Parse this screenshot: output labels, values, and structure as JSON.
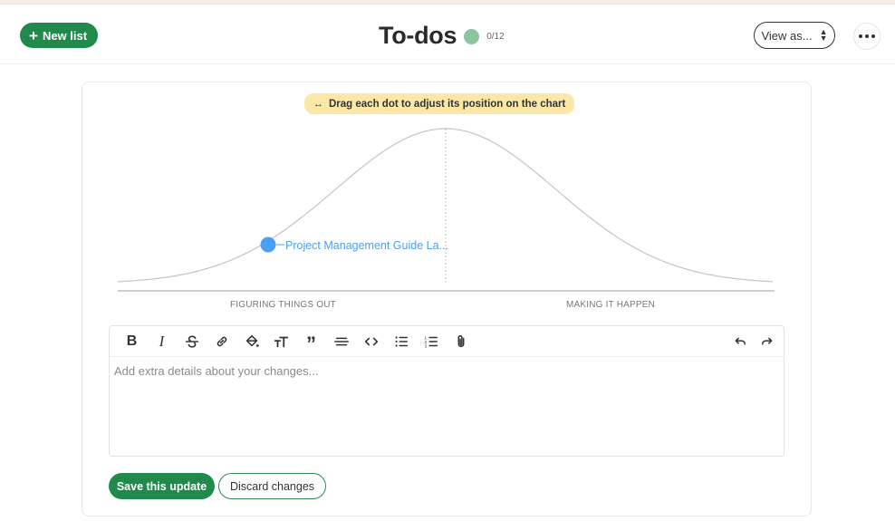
{
  "header": {
    "new_list_label": "New list",
    "title": "To-dos",
    "progress_count": "0/12",
    "view_as_label": "View as..."
  },
  "hillchart": {
    "hint": "Drag each dot to adjust its position on the chart",
    "left_label": "FIGURING THINGS OUT",
    "right_label": "MAKING IT HAPPEN",
    "item_label": "Project Management Guide La...",
    "item_color": "#4a9ff5"
  },
  "editor": {
    "placeholder": "Add extra details about your changes..."
  },
  "actions": {
    "save_label": "Save this update",
    "discard_label": "Discard changes"
  },
  "colors": {
    "brand_green": "#1f8a4c",
    "progress_dot": "#8ec3a0",
    "hint_bg": "#fbe8a6"
  }
}
